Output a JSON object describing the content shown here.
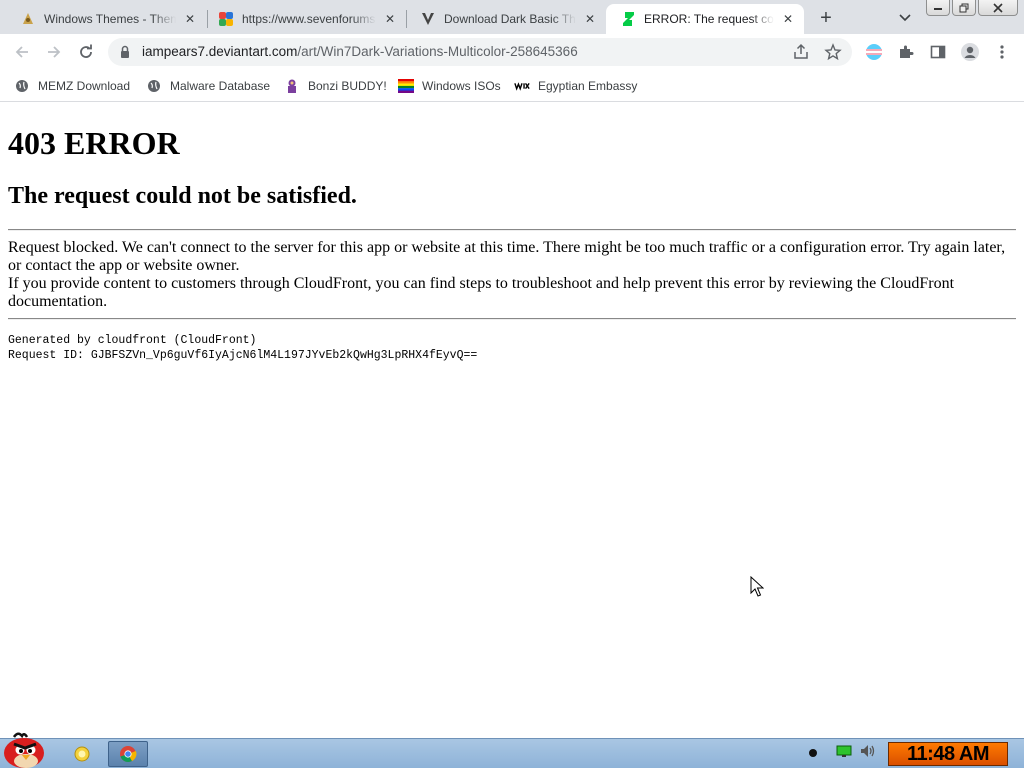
{
  "browser": {
    "tabs": [
      {
        "title": "Windows Themes - Themes",
        "favicon": "themes-favicon",
        "active": false
      },
      {
        "title": "https://www.sevenforums.com",
        "favicon": "sevenforums-favicon",
        "active": false
      },
      {
        "title": "Download Dark Basic Theme",
        "favicon": "download-favicon",
        "active": false
      },
      {
        "title": "ERROR: The request could not be satisfied",
        "favicon": "deviantart-favicon",
        "active": true
      }
    ],
    "new_tab_label": "+",
    "url": {
      "domain": "iampears7.deviantart.com",
      "path": "/art/Win7Dark-Variations-Multicolor-258645366"
    },
    "bookmarks": [
      {
        "label": "MEMZ Download",
        "icon": "globe-icon"
      },
      {
        "label": "Malware Database",
        "icon": "globe-icon"
      },
      {
        "label": "Bonzi BUDDY!",
        "icon": "bonzi-icon"
      },
      {
        "label": "Windows ISOs",
        "icon": "rainbow-flag-icon"
      },
      {
        "label": "Egyptian Embassy",
        "icon": "wix-icon"
      }
    ]
  },
  "page": {
    "heading": "403 ERROR",
    "subheading": "The request could not be satisfied.",
    "message_line1": "Request blocked. We can't connect to the server for this app or website at this time. There might be too much traffic or a configuration error. Try again later, or contact the app or website owner.",
    "message_line2": "If you provide content to customers through CloudFront, you can find steps to troubleshoot and help prevent this error by reviewing the CloudFront documentation.",
    "generated_by": "Generated by cloudfront (CloudFront)",
    "request_id": "Request ID: GJBFSZVn_Vp6guVf6IyAjcN6lM4L197JYvEb2kQwHg3LpRHX4fEyvQ=="
  },
  "taskbar": {
    "clock": "11:48 AM",
    "apps": [
      "windows-explorer",
      "google-chrome"
    ],
    "tray_icons": [
      "record-icon",
      "network-icon",
      "volume-icon"
    ]
  },
  "colors": {
    "tabstrip_bg": "#dee1e6",
    "omnibox_bg": "#f1f3f4",
    "taskbar_bg": "#9bbde0",
    "clock_bg": "#ff7a00"
  }
}
